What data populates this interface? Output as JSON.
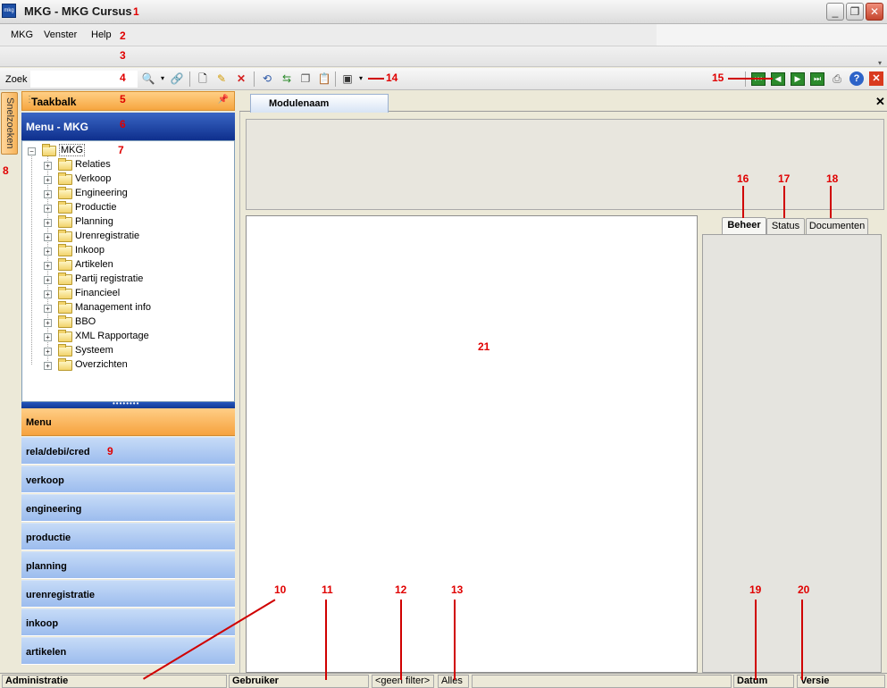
{
  "window": {
    "title": "MKG - MKG Cursus",
    "icon_text": "mkg"
  },
  "menubar": {
    "items": [
      "MKG",
      "Venster",
      "Help"
    ]
  },
  "toolbar": {
    "search_label": "Zoek",
    "search_value": ""
  },
  "snelzoeken": {
    "label": "Snelzoeken"
  },
  "taakbalk": {
    "label": "Taakbalk"
  },
  "menu_header": {
    "label": "Menu - MKG"
  },
  "tree": {
    "root": "MKG",
    "items": [
      "Relaties",
      "Verkoop",
      "Engineering",
      "Productie",
      "Planning",
      "Urenregistratie",
      "Inkoop",
      "Artikelen",
      "Partij registratie",
      "Financieel",
      "Management info",
      "BBO",
      "XML Rapportage",
      "Systeem",
      "Overzichten"
    ]
  },
  "menu_section": {
    "label": "Menu"
  },
  "categories": [
    "rela/debi/cred",
    "verkoop",
    "engineering",
    "productie",
    "planning",
    "urenregistratie",
    "inkoop",
    "artikelen"
  ],
  "main": {
    "tab_label": "Modulenaam",
    "right_tabs": [
      "Beheer",
      "Status",
      "Documenten"
    ],
    "active_right_tab": "Beheer"
  },
  "statusbar": {
    "administratie": "Administratie",
    "gebruiker": "Gebruiker",
    "filter": "<geen filter>",
    "scope": "Alles",
    "datum": "Datum",
    "versie": "Versie"
  },
  "annotations": {
    "a1": "1",
    "a2": "2",
    "a3": "3",
    "a4": "4",
    "a5": "5",
    "a6": "6",
    "a7": "7",
    "a8": "8",
    "a9": "9",
    "a10": "10",
    "a11": "11",
    "a12": "12",
    "a13": "13",
    "a14": "14",
    "a15": "15",
    "a16": "16",
    "a17": "17",
    "a18": "18",
    "a19": "19",
    "a20": "20",
    "a21": "21"
  },
  "colors": {
    "annotation": "#e00000",
    "menu_header": "#0e2f8d",
    "taakbalk": "#f6a640",
    "category": "#9cbcee"
  }
}
